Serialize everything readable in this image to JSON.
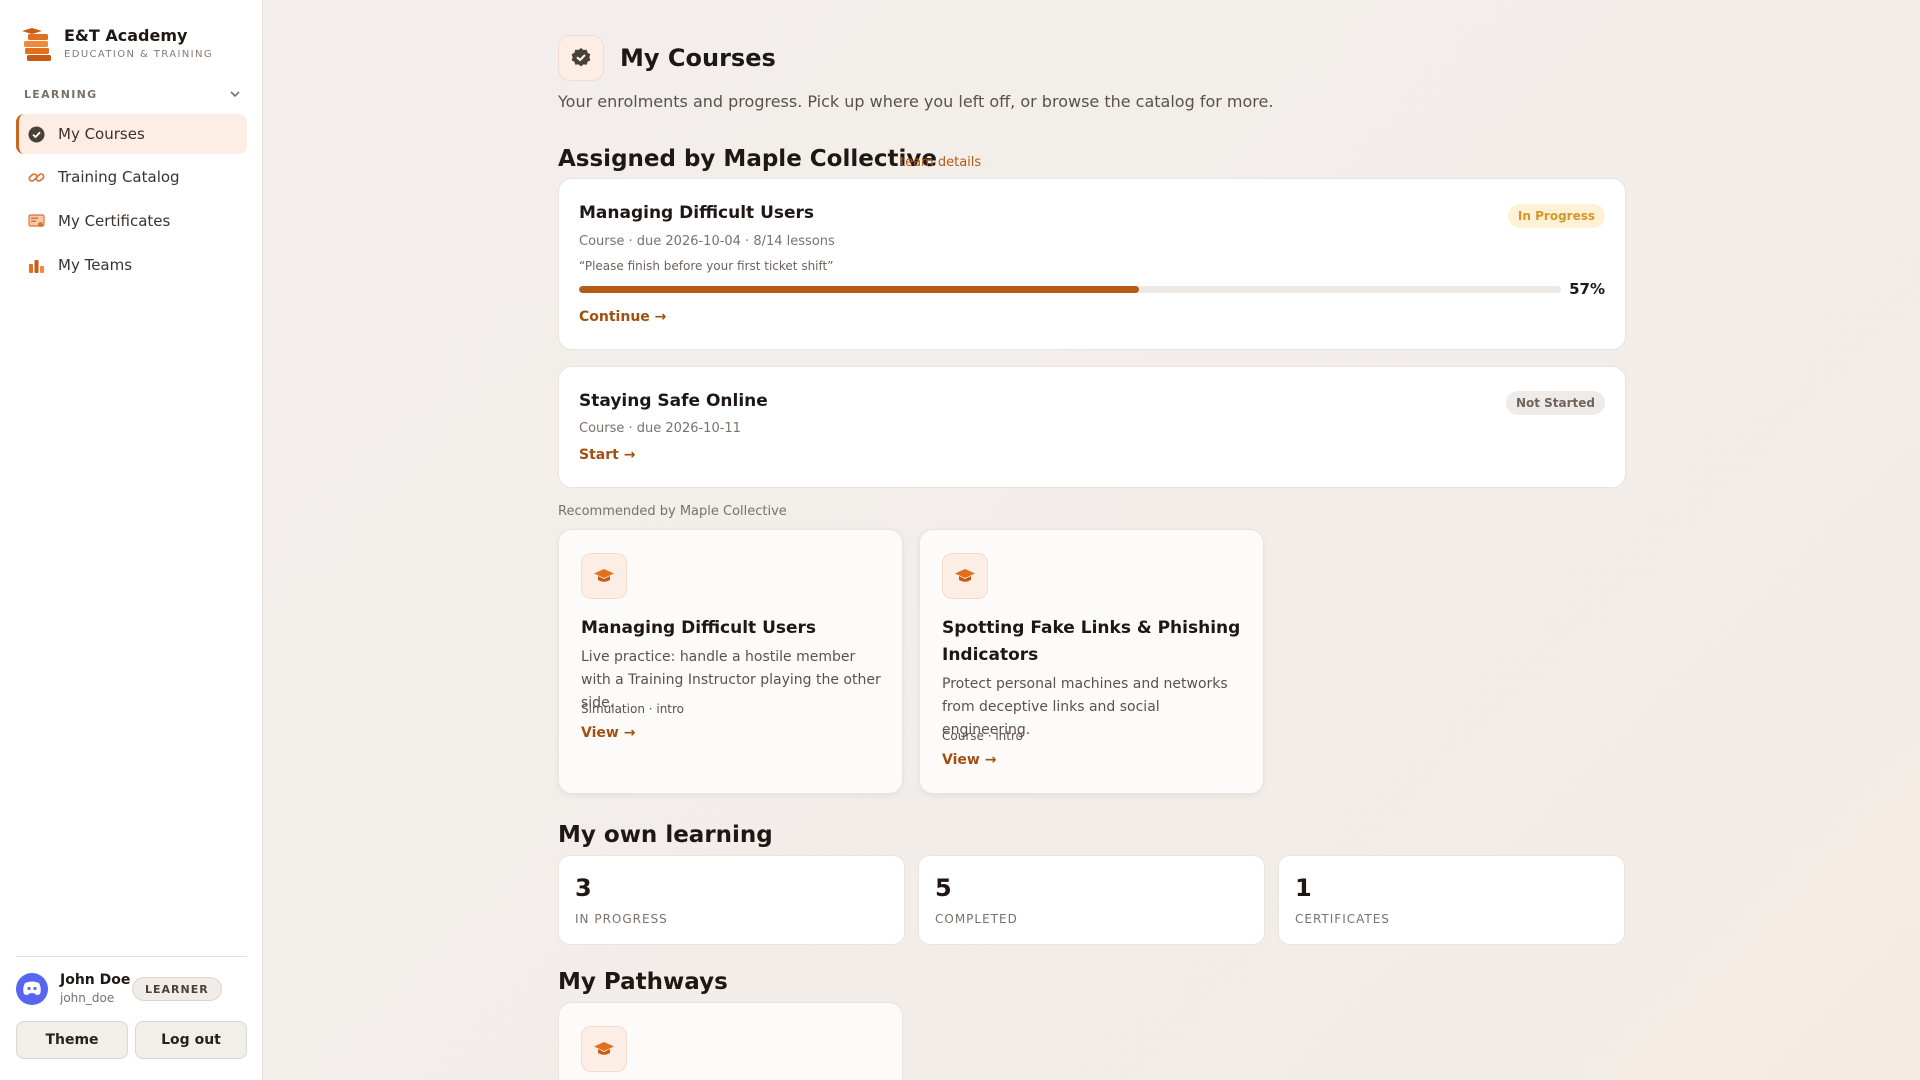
{
  "brand": {
    "name": "E&T Academy",
    "subtitle": "EDUCATION & TRAINING"
  },
  "sidebar": {
    "section_label": "LEARNING",
    "items": [
      {
        "label": "My Courses",
        "icon": "badge-check-icon",
        "active": true
      },
      {
        "label": "Training Catalog",
        "icon": "link-icon"
      },
      {
        "label": "My Certificates",
        "icon": "certificate-icon"
      },
      {
        "label": "My Teams",
        "icon": "team-icon"
      }
    ]
  },
  "user": {
    "name": "John Doe",
    "handle": "john_doe",
    "role": "LEARNER"
  },
  "footer": {
    "theme_label": "Theme",
    "logout_label": "Log out"
  },
  "header": {
    "title": "My Courses",
    "subtitle": "Your enrolments and progress. Pick up where you left off, or browse the catalog for more."
  },
  "assigned": {
    "heading": "Assigned by Maple Collective",
    "team_link": "team details",
    "courses": [
      {
        "title": "Managing Difficult Users",
        "meta": "Course · due 2026-10-04 · 8/14 lessons",
        "note": "“Please finish before your first ticket shift”",
        "status": "In Progress",
        "progress": 57,
        "progress_label": "57%",
        "action": "Continue →"
      },
      {
        "title": "Staying Safe Online",
        "meta": "Course · due 2026-10-11",
        "status": "Not Started",
        "action": "Start →"
      }
    ]
  },
  "recommended": {
    "label": "Recommended by Maple Collective",
    "items": [
      {
        "title": "Managing Difficult Users",
        "description": "Live practice: handle a hostile member with a Training Instructor playing the other side.",
        "meta": "Simulation · intro",
        "action": "View →"
      },
      {
        "title": "Spotting Fake Links & Phishing Indicators",
        "description": "Protect personal machines and networks from deceptive links and social engineering.",
        "meta": "Course · intro",
        "action": "View →"
      }
    ]
  },
  "own_learning": {
    "heading": "My own learning",
    "stats": [
      {
        "value": "3",
        "label": "IN PROGRESS"
      },
      {
        "value": "5",
        "label": "COMPLETED"
      },
      {
        "value": "1",
        "label": "CERTIFICATES"
      }
    ]
  },
  "pathways": {
    "heading": "My Pathways"
  },
  "colors": {
    "accent": "#b65a14",
    "accent_bg": "#fdeee5",
    "status_progress": "#d6962a",
    "discord": "#5865f2"
  }
}
